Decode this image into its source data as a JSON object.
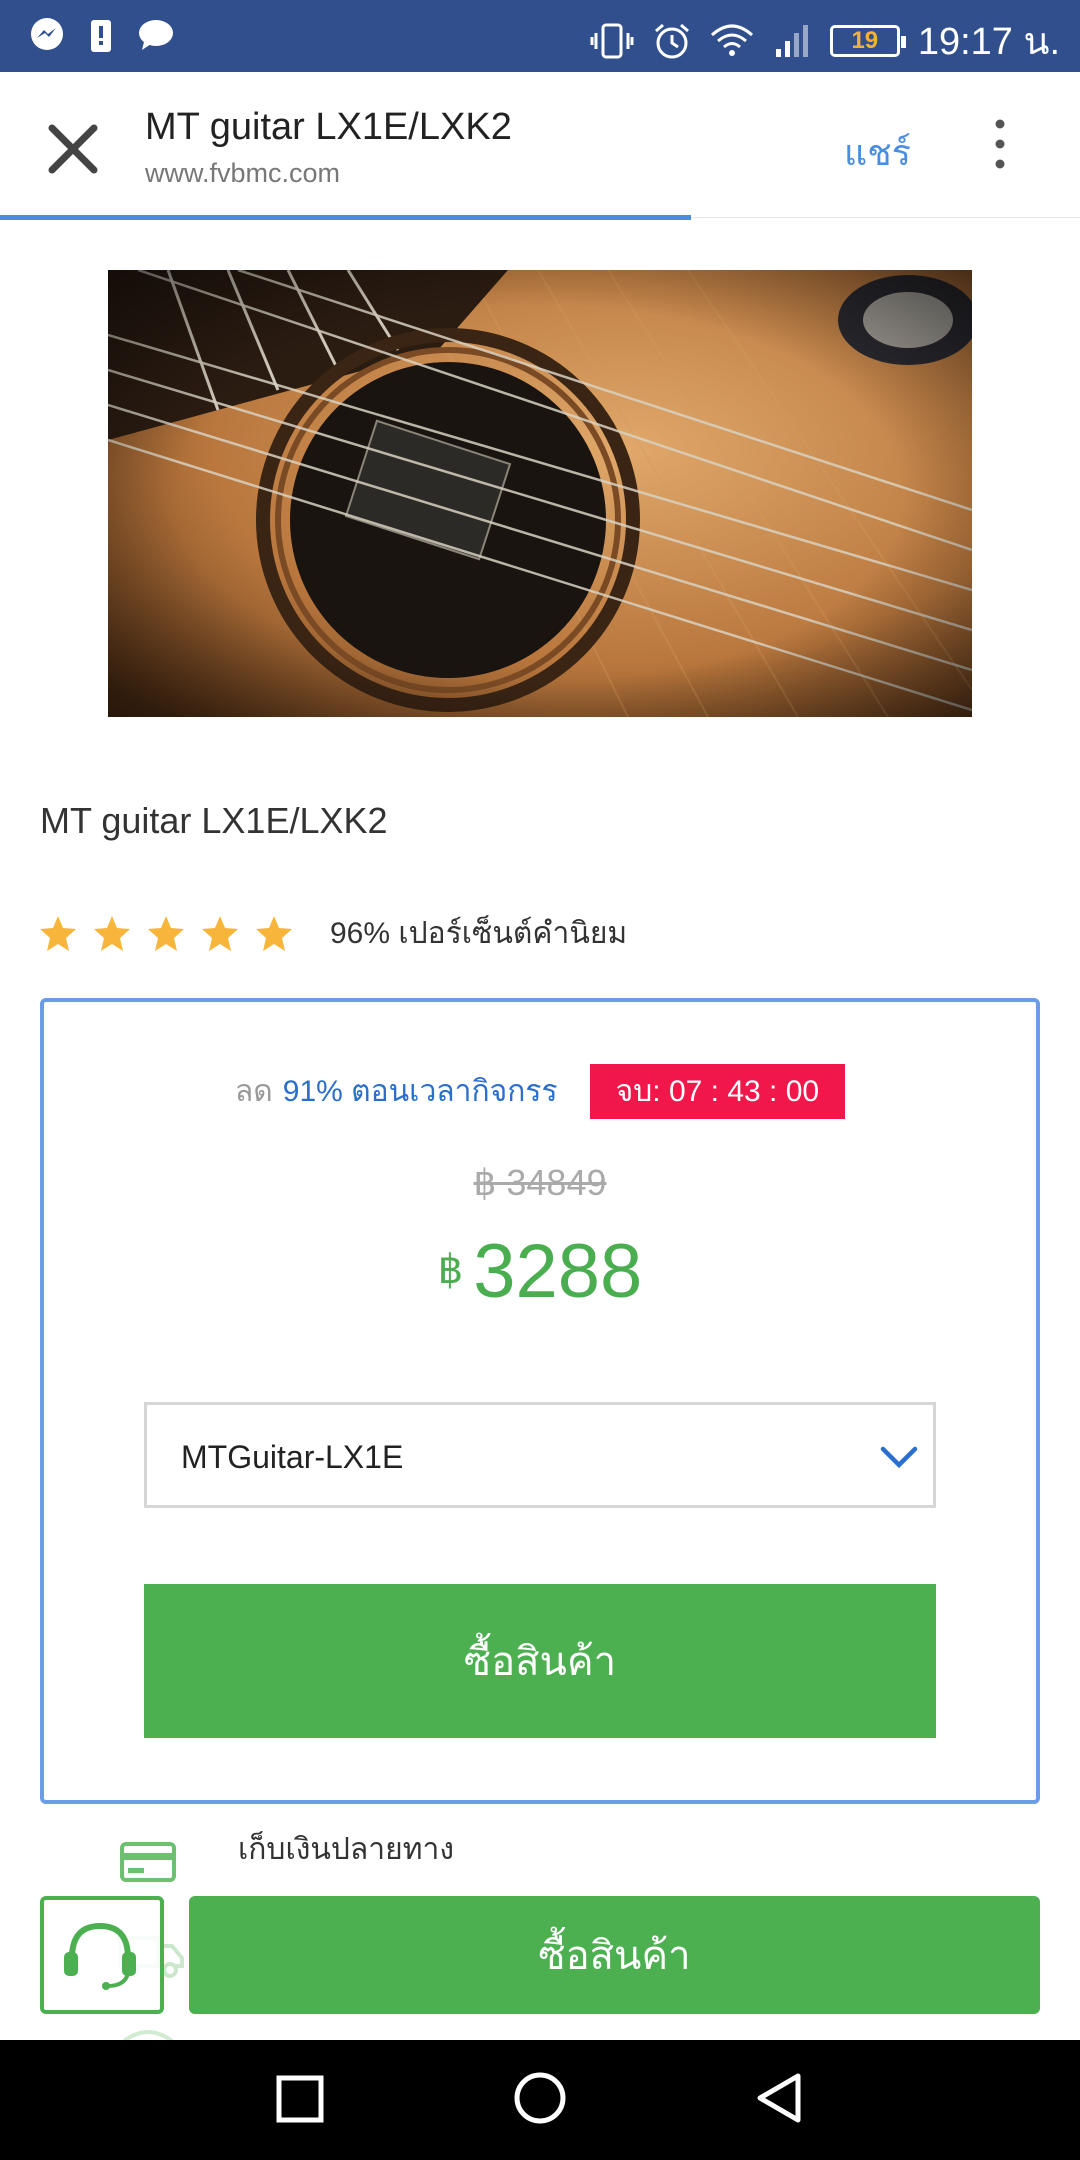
{
  "status_bar": {
    "time": "19:17 น.",
    "battery": "19",
    "icons": [
      "messenger-icon",
      "battery-saver-icon",
      "chat-icon",
      "vibrate-icon",
      "alarm-icon",
      "wifi-icon",
      "signal-icon"
    ]
  },
  "browser": {
    "title": "MT guitar LX1E/LXK2",
    "url": "www.fvbmc.com",
    "share_label": "แชร์",
    "load_progress": 0.64
  },
  "product": {
    "name": "MT guitar LX1E/LXK2",
    "rating_stars": 5,
    "rating_text": "96% เปอร์เซ็นต์คำนิยม"
  },
  "offer": {
    "discount_prefix": "ลด",
    "discount_text": "91% ตอนเวลากิจกรร",
    "timer": "จบ: 07 : 43 : 00",
    "old_price": "฿ 34849",
    "currency": "฿",
    "new_price": "3288",
    "variant": "MTGuitar-LX1E",
    "buy_label": "ซื้อสินค้า"
  },
  "payment": {
    "cod_label": "เก็บเงินปลายทาง"
  },
  "bottom_bar": {
    "buy_label": "ซื้อสินค้า"
  },
  "colors": {
    "status_bar": "#304f8c",
    "accent_blue": "#4a8de0",
    "green": "#4caf50",
    "timer_red": "#f2174a",
    "star": "#f7b53b"
  }
}
